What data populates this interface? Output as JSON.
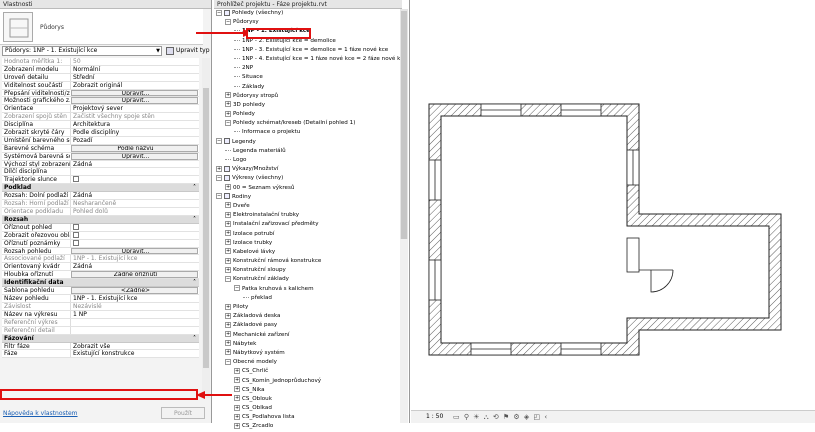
{
  "properties": {
    "title": "Vlastnosti",
    "type_name": "Půdorys",
    "filter_value": "Půdorys: 1NP - 1. Existující kce",
    "edit_type": "Upravit typ",
    "rows": [
      {
        "kind": "row",
        "k": "Hodnota měřítka   1:",
        "v": "50",
        "gray": true
      },
      {
        "kind": "row",
        "k": "Zobrazení modelu",
        "v": "Normální"
      },
      {
        "kind": "row",
        "k": "Úroveň detailu",
        "v": "Střední"
      },
      {
        "kind": "row",
        "k": "Viditelnost součástí",
        "v": "Zobrazit originál"
      },
      {
        "kind": "row",
        "k": "Přepsání viditelnosti/z...",
        "v": "Upravit...",
        "btn": true
      },
      {
        "kind": "row",
        "k": "Možnosti grafického z...",
        "v": "Upravit...",
        "btn": true
      },
      {
        "kind": "row",
        "k": "Orientace",
        "v": "Projektový sever"
      },
      {
        "kind": "row",
        "k": "Zobrazení spojů stěn",
        "v": "Začistit všechny spoje stěn",
        "gray": true
      },
      {
        "kind": "row",
        "k": "Disciplína",
        "v": "Architektura"
      },
      {
        "kind": "row",
        "k": "Zobrazit skryté čáry",
        "v": "Podle disciplíny"
      },
      {
        "kind": "row",
        "k": "Umístění barevného sc...",
        "v": "Pozadí"
      },
      {
        "kind": "row",
        "k": "Barevné schéma",
        "v": "Podle názvu",
        "btn": true
      },
      {
        "kind": "row",
        "k": "Systémová barevná sc...",
        "v": "Upravit...",
        "btn": true
      },
      {
        "kind": "row",
        "k": "Výchozí styl zobrazení ...",
        "v": "Žádná"
      },
      {
        "kind": "row",
        "k": "Dílčí disciplína",
        "v": ""
      },
      {
        "kind": "row",
        "k": "Trajektorie slunce",
        "v": "",
        "cb": true
      },
      {
        "kind": "group",
        "label": "Podklad"
      },
      {
        "kind": "row",
        "k": "Rozsah: Dolní podlaží",
        "v": "Žádná"
      },
      {
        "kind": "row",
        "k": "Rozsah: Horní podlaží",
        "v": "Nesharančeně",
        "gray": true
      },
      {
        "kind": "row",
        "k": "Orientace podkladu",
        "v": "Pohled dolů",
        "gray": true
      },
      {
        "kind": "group",
        "label": "Rozsah"
      },
      {
        "kind": "row",
        "k": "Oříznout pohled",
        "v": "",
        "cb": true
      },
      {
        "kind": "row",
        "k": "Zobrazit ořezovou oblast",
        "v": "",
        "cb": true
      },
      {
        "kind": "row",
        "k": "Oříznutí poznámky",
        "v": "",
        "cb": true
      },
      {
        "kind": "row",
        "k": "Rozsah pohledu",
        "v": "Upravit...",
        "btn": true
      },
      {
        "kind": "row",
        "k": "Associované podlaží",
        "v": "1NP - 1. Existující kce",
        "gray": true
      },
      {
        "kind": "row",
        "k": "Orientovaný kvádr",
        "v": "Žádná"
      },
      {
        "kind": "row",
        "k": "Hloubka oříznutí",
        "v": "Žádné oříznutí",
        "btn": true
      },
      {
        "kind": "group",
        "label": "Identifikační data"
      },
      {
        "kind": "row",
        "k": "Šablona pohledu",
        "v": "<Žádné>",
        "btn": true
      },
      {
        "kind": "row",
        "k": "Název pohledu",
        "v": "1NP - 1. Existující kce"
      },
      {
        "kind": "row",
        "k": "Závislost",
        "v": "Nezávislé",
        "gray": true
      },
      {
        "kind": "row",
        "k": "Název na výkresu",
        "v": "1 NP"
      },
      {
        "kind": "row",
        "k": "Referenční výkres",
        "v": "",
        "gray": true
      },
      {
        "kind": "row",
        "k": "Referenční detail",
        "v": "",
        "gray": true
      },
      {
        "kind": "group",
        "label": "Fázování"
      },
      {
        "kind": "row",
        "k": "Filtr fáze",
        "v": "Zobrazit vše"
      },
      {
        "kind": "row",
        "k": "Fáze",
        "v": "Existující konstrukce"
      }
    ],
    "help_link": "Nápověda k vlastnostem",
    "apply": "Použít"
  },
  "browser": {
    "title": "Prohlížeč projektu - Fáze projektu.rvt",
    "items": [
      {
        "level": 0,
        "toggle": "-",
        "icon": true,
        "label": "Pohledy (všechny)"
      },
      {
        "level": 1,
        "toggle": "-",
        "label": "Půdorysy"
      },
      {
        "level": 2,
        "label": "1NP - 1. Existující kce",
        "sel": true
      },
      {
        "level": 2,
        "label": "1NP - 2. Existující kce = demolice"
      },
      {
        "level": 2,
        "label": "1NP - 3. Existující kce = demolice = 1 fáze nové kce"
      },
      {
        "level": 2,
        "label": "1NP - 4. Existující kce = 1 fáze nové kce = 2 fáze nové kce"
      },
      {
        "level": 2,
        "label": "2NP"
      },
      {
        "level": 2,
        "label": "Situace"
      },
      {
        "level": 2,
        "label": "Základy"
      },
      {
        "level": 1,
        "toggle": "+",
        "label": "Půdorysy stropů"
      },
      {
        "level": 1,
        "toggle": "+",
        "label": "3D pohledy"
      },
      {
        "level": 1,
        "toggle": "+",
        "label": "Pohledy"
      },
      {
        "level": 1,
        "toggle": "-",
        "label": "Pohledy schémat/kreseb (Detailní pohled 1)"
      },
      {
        "level": 2,
        "label": "Informace o projektu"
      },
      {
        "level": 0,
        "toggle": "-",
        "icon": true,
        "label": "Legendy"
      },
      {
        "level": 1,
        "label": "Legenda materiálů"
      },
      {
        "level": 1,
        "label": "Logo"
      },
      {
        "level": 0,
        "toggle": "+",
        "icon": true,
        "label": "Výkazy/Množství"
      },
      {
        "level": 0,
        "toggle": "-",
        "icon": true,
        "label": "Výkresy (všechny)"
      },
      {
        "level": 1,
        "toggle": "+",
        "label": "00 = Seznam výkresů"
      },
      {
        "level": 0,
        "toggle": "-",
        "icon": true,
        "label": "Rodiny"
      },
      {
        "level": 1,
        "toggle": "+",
        "label": "Dveře"
      },
      {
        "level": 1,
        "toggle": "+",
        "label": "Elektroinstalační trubky"
      },
      {
        "level": 1,
        "toggle": "+",
        "label": "Instalační zařizovací předměty"
      },
      {
        "level": 1,
        "toggle": "+",
        "label": "Izolace potrubí"
      },
      {
        "level": 1,
        "toggle": "+",
        "label": "Izolace trubky"
      },
      {
        "level": 1,
        "toggle": "+",
        "label": "Kabelové lávky"
      },
      {
        "level": 1,
        "toggle": "+",
        "label": "Konstrukční rámová konstrukce"
      },
      {
        "level": 1,
        "toggle": "+",
        "label": "Konstrukční sloupy"
      },
      {
        "level": 1,
        "toggle": "-",
        "label": "Konstrukční základy"
      },
      {
        "level": 2,
        "toggle": "-",
        "label": "Patka kruhová s kalichem"
      },
      {
        "level": 3,
        "label": "překlad"
      },
      {
        "level": 1,
        "toggle": "+",
        "label": "Piloty"
      },
      {
        "level": 1,
        "toggle": "+",
        "label": "Základová deska"
      },
      {
        "level": 1,
        "toggle": "+",
        "label": "Základové pasy"
      },
      {
        "level": 1,
        "toggle": "+",
        "label": "Mechanické zařízení"
      },
      {
        "level": 1,
        "toggle": "+",
        "label": "Nábytek"
      },
      {
        "level": 1,
        "toggle": "+",
        "label": "Nábytkový systém"
      },
      {
        "level": 1,
        "toggle": "-",
        "label": "Obecné modely"
      },
      {
        "level": 2,
        "toggle": "+",
        "label": "CS_Chrlič"
      },
      {
        "level": 2,
        "toggle": "+",
        "label": "CS_Komín_jednoprůduchový"
      },
      {
        "level": 2,
        "toggle": "+",
        "label": "CS_Nika"
      },
      {
        "level": 2,
        "toggle": "+",
        "label": "CS_Oblouk"
      },
      {
        "level": 2,
        "toggle": "+",
        "label": "CS_Oblkad"
      },
      {
        "level": 2,
        "toggle": "+",
        "label": "CS_Podlahova lista"
      },
      {
        "level": 2,
        "toggle": "+",
        "label": "CS_Zrcadlo"
      }
    ]
  },
  "status": {
    "scale": "1 : 50",
    "icons": "▭ ⚲ ☀ ⛬ ⟲ ⚑ ⚙ ◈ ◰ ‹"
  },
  "colors": {
    "highlight": "#e01010",
    "link": "#1a5fb4"
  }
}
